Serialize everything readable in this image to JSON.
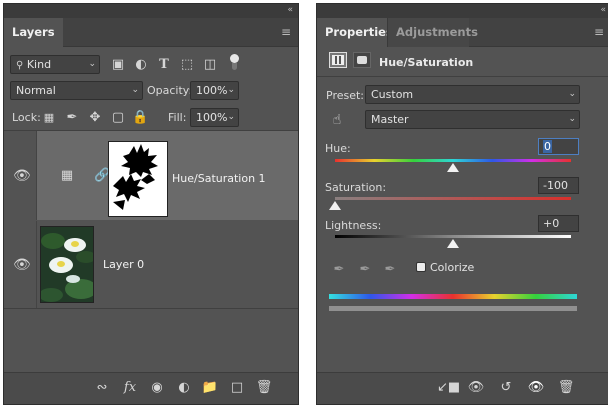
{
  "layers_panel": {
    "tab": "Layers",
    "filter": {
      "value": "Kind"
    },
    "blend_mode": "Normal",
    "opacity_label": "Opacity:",
    "opacity_value": "100%",
    "lock_label": "Lock:",
    "fill_label": "Fill:",
    "fill_value": "100%",
    "layers": [
      {
        "name": "Hue/Saturation 1",
        "visible": true,
        "selected": true
      },
      {
        "name": "Layer 0",
        "visible": true,
        "selected": false
      }
    ]
  },
  "properties_panel": {
    "tabs": [
      "Properties",
      "Adjustments"
    ],
    "adjustment_title": "Hue/Saturation",
    "preset_label": "Preset:",
    "preset_value": "Custom",
    "channel_value": "Master",
    "hue_label": "Hue:",
    "hue_value": "0",
    "saturation_label": "Saturation:",
    "saturation_value": "-100",
    "lightness_label": "Lightness:",
    "lightness_value": "+0",
    "colorize_label": "Colorize",
    "colorize_checked": false,
    "levels": {
      "hue": 0.5,
      "saturation": 0.0,
      "lightness": 0.5
    }
  },
  "icons": {
    "collapse": "«",
    "panel_menu": "≡"
  }
}
